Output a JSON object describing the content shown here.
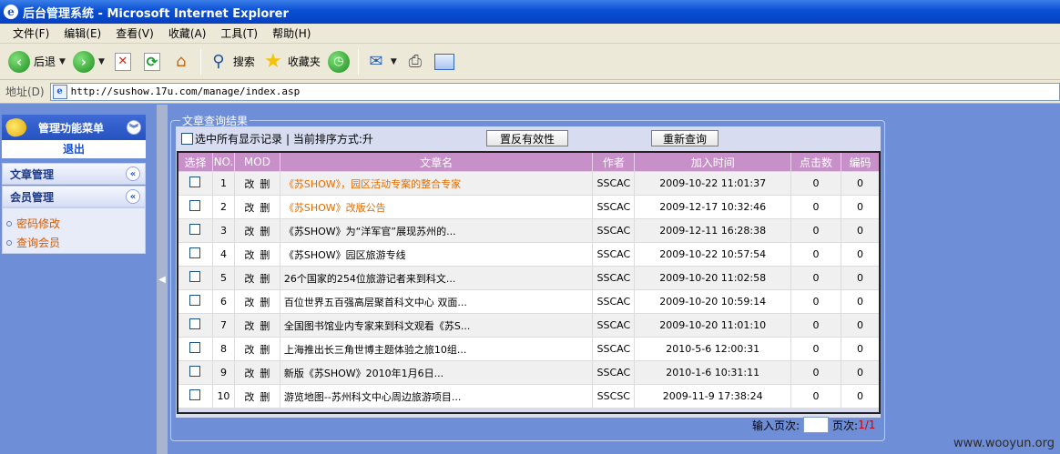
{
  "window": {
    "title": "后台管理系统 - Microsoft Internet Explorer"
  },
  "menubar": [
    "文件(F)",
    "编辑(E)",
    "查看(V)",
    "收藏(A)",
    "工具(T)",
    "帮助(H)"
  ],
  "toolbar": {
    "back": "后退",
    "search": "搜索",
    "favorites": "收藏夹"
  },
  "address": {
    "label": "地址(D)",
    "url": "http://sushow.17u.com/manage/index.asp"
  },
  "sidebar": {
    "header": "管理功能菜单",
    "logout": "退出",
    "sections": [
      "文章管理",
      "会员管理"
    ],
    "items": [
      "密码修改",
      "查询会员"
    ]
  },
  "content": {
    "legend": "文章查询结果",
    "select_all_label": "选中所有显示记录",
    "sort_label": "| 当前排序方式:升",
    "invert_button": "置反有效性",
    "requery_button": "重新查询",
    "columns": [
      "选择",
      "NO.",
      "MOD",
      "文章名",
      "作者",
      "加入时间",
      "点击数",
      "编码"
    ],
    "rows": [
      {
        "no": "1",
        "edit": "改",
        "del": "删",
        "title": "《苏SHOW》，园区活动专案的整合专家",
        "author": "SSCAC",
        "time": "2009-10-22 11:01:37",
        "clicks": "0",
        "code": "0",
        "highlight": true
      },
      {
        "no": "2",
        "edit": "改",
        "del": "删",
        "title": "《苏SHOW》改版公告",
        "author": "SSCAC",
        "time": "2009-12-17 10:32:46",
        "clicks": "0",
        "code": "0",
        "highlight": true
      },
      {
        "no": "3",
        "edit": "改",
        "del": "删",
        "title": "《苏SHOW》为“洋军官”展现苏州的...",
        "author": "SSCAC",
        "time": "2009-12-11 16:28:38",
        "clicks": "0",
        "code": "0",
        "highlight": false
      },
      {
        "no": "4",
        "edit": "改",
        "del": "删",
        "title": "《苏SHOW》园区旅游专线",
        "author": "SSCAC",
        "time": "2009-10-22 10:57:54",
        "clicks": "0",
        "code": "0",
        "highlight": false
      },
      {
        "no": "5",
        "edit": "改",
        "del": "删",
        "title": "26个国家的254位旅游记者来到科文...",
        "author": "SSCAC",
        "time": "2009-10-20 11:02:58",
        "clicks": "0",
        "code": "0",
        "highlight": false
      },
      {
        "no": "6",
        "edit": "改",
        "del": "删",
        "title": "百位世界五百强高层聚首科文中心 双面...",
        "author": "SSCAC",
        "time": "2009-10-20 10:59:14",
        "clicks": "0",
        "code": "0",
        "highlight": false
      },
      {
        "no": "7",
        "edit": "改",
        "del": "删",
        "title": "全国图书馆业内专家来到科文观看《苏S...",
        "author": "SSCAC",
        "time": "2009-10-20 11:01:10",
        "clicks": "0",
        "code": "0",
        "highlight": false
      },
      {
        "no": "8",
        "edit": "改",
        "del": "删",
        "title": "上海推出长三角世博主题体验之旅10组...",
        "author": "SSCAC",
        "time": "2010-5-6 12:00:31",
        "clicks": "0",
        "code": "0",
        "highlight": false
      },
      {
        "no": "9",
        "edit": "改",
        "del": "删",
        "title": "新版《苏SHOW》2010年1月6日...",
        "author": "SSCAC",
        "time": "2010-1-6 10:31:11",
        "clicks": "0",
        "code": "0",
        "highlight": false
      },
      {
        "no": "10",
        "edit": "改",
        "del": "删",
        "title": "游览地图--苏州科文中心周边旅游项目...",
        "author": "SSCSC",
        "time": "2009-11-9 17:38:24",
        "clicks": "0",
        "code": "0",
        "highlight": false
      }
    ],
    "pager": {
      "input_label": "输入页次:",
      "page_label": "页次:",
      "page_value": "1/1"
    }
  },
  "watermark": "www.wooyun.org",
  "colors": {
    "accent": "#2553c0",
    "header_row": "#c790c8",
    "highlight_text": "#e46c00",
    "background": "#6f8ed8"
  }
}
